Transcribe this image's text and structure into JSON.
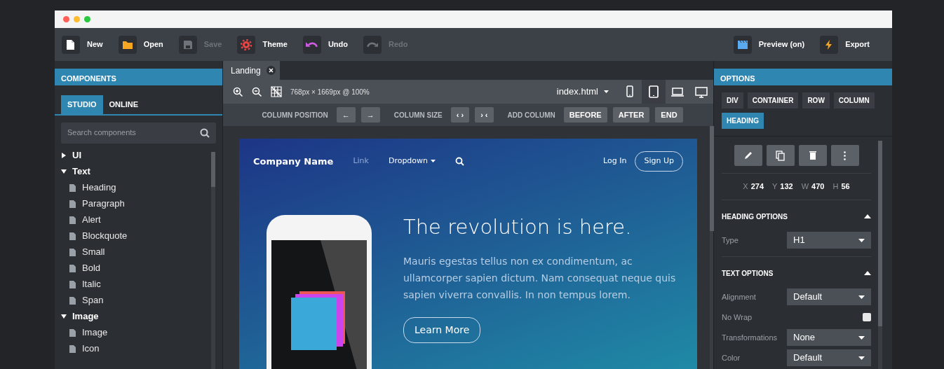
{
  "toolbar": {
    "left": [
      {
        "label": "New",
        "kind": "file",
        "disabled": false
      },
      {
        "label": "Open",
        "kind": "folder",
        "disabled": false
      },
      {
        "label": "Save",
        "kind": "disk",
        "disabled": true
      },
      {
        "label": "Theme",
        "kind": "gear",
        "disabled": false
      },
      {
        "label": "Undo",
        "kind": "undo",
        "disabled": false
      },
      {
        "label": "Redo",
        "kind": "redo",
        "disabled": true
      }
    ],
    "right": [
      {
        "label": "Preview (on)",
        "kind": "clapper",
        "disabled": false
      },
      {
        "label": "Export",
        "kind": "bolt",
        "disabled": false
      }
    ]
  },
  "components": {
    "title": "COMPONENTS",
    "tabs": [
      {
        "label": "STUDIO",
        "selected": true
      },
      {
        "label": "ONLINE",
        "selected": false
      }
    ],
    "search": {
      "placeholder": "Search components"
    },
    "tree": [
      {
        "label": "UI",
        "expanded": false
      },
      {
        "label": "Text",
        "expanded": true,
        "children": [
          {
            "label": "Heading"
          },
          {
            "label": "Paragraph"
          },
          {
            "label": "Alert"
          },
          {
            "label": "Blockquote"
          },
          {
            "label": "Small"
          },
          {
            "label": "Bold"
          },
          {
            "label": "Italic"
          },
          {
            "label": "Span"
          }
        ]
      },
      {
        "label": "Image",
        "expanded": true,
        "children": [
          {
            "label": "Image"
          },
          {
            "label": "Icon"
          }
        ]
      }
    ]
  },
  "editor": {
    "tabs": [
      {
        "label": "Landing",
        "selected": true
      }
    ],
    "size_info": "768px × 1669px @ 100%",
    "file": "index.html",
    "devices": [
      {
        "kind": "phone",
        "selected": false
      },
      {
        "kind": "tablet",
        "selected": true
      },
      {
        "kind": "laptop",
        "selected": false
      },
      {
        "kind": "desktop",
        "selected": false
      }
    ],
    "column_bar": [
      {
        "label": "COLUMN POSITION",
        "buttons": [
          "←",
          "→"
        ]
      },
      {
        "label": "COLUMN SIZE",
        "buttons": [
          "‹ ›",
          "› ‹"
        ]
      },
      {
        "label": "ADD COLUMN",
        "buttons": [
          "BEFORE",
          "AFTER",
          "END"
        ]
      }
    ],
    "preview": {
      "brand": "Company Name",
      "nav": [
        {
          "label": "Link",
          "kind": "link"
        },
        {
          "label": "Dropdown",
          "kind": "dropdown"
        }
      ],
      "login": "Log In",
      "signup": "Sign Up",
      "heading": "The revolution is here.",
      "text": "Mauris egestas tellus non ex condimentum, ac ullamcorper sapien dictum. Nam consequat neque quis sapien viverra convallis. In non tempus lorem.",
      "button": "Learn More"
    }
  },
  "options": {
    "title": "OPTIONS",
    "breadcrumbs": [
      {
        "label": "DIV",
        "selected": false
      },
      {
        "label": "CONTAINER",
        "selected": false
      },
      {
        "label": "ROW",
        "selected": false
      },
      {
        "label": "COLUMN",
        "selected": false
      },
      {
        "label": "HEADING",
        "selected": true
      }
    ],
    "geometry": [
      {
        "axis": "X",
        "value": "274"
      },
      {
        "axis": "Y",
        "value": "132"
      },
      {
        "axis": "W",
        "value": "470"
      },
      {
        "axis": "H",
        "value": "56"
      }
    ],
    "sections": [
      {
        "title": "HEADING OPTIONS",
        "expanded": true,
        "fields": [
          {
            "kind": "select",
            "label": "Type",
            "value": "H1"
          }
        ]
      },
      {
        "title": "TEXT OPTIONS",
        "expanded": true,
        "fields": [
          {
            "kind": "select",
            "label": "Alignment",
            "value": "Default"
          },
          {
            "kind": "checkbox",
            "label": "No Wrap",
            "checked": false
          },
          {
            "kind": "select",
            "label": "Transformations",
            "value": "None"
          },
          {
            "kind": "select",
            "label": "Color",
            "value": "Default"
          }
        ]
      }
    ]
  }
}
